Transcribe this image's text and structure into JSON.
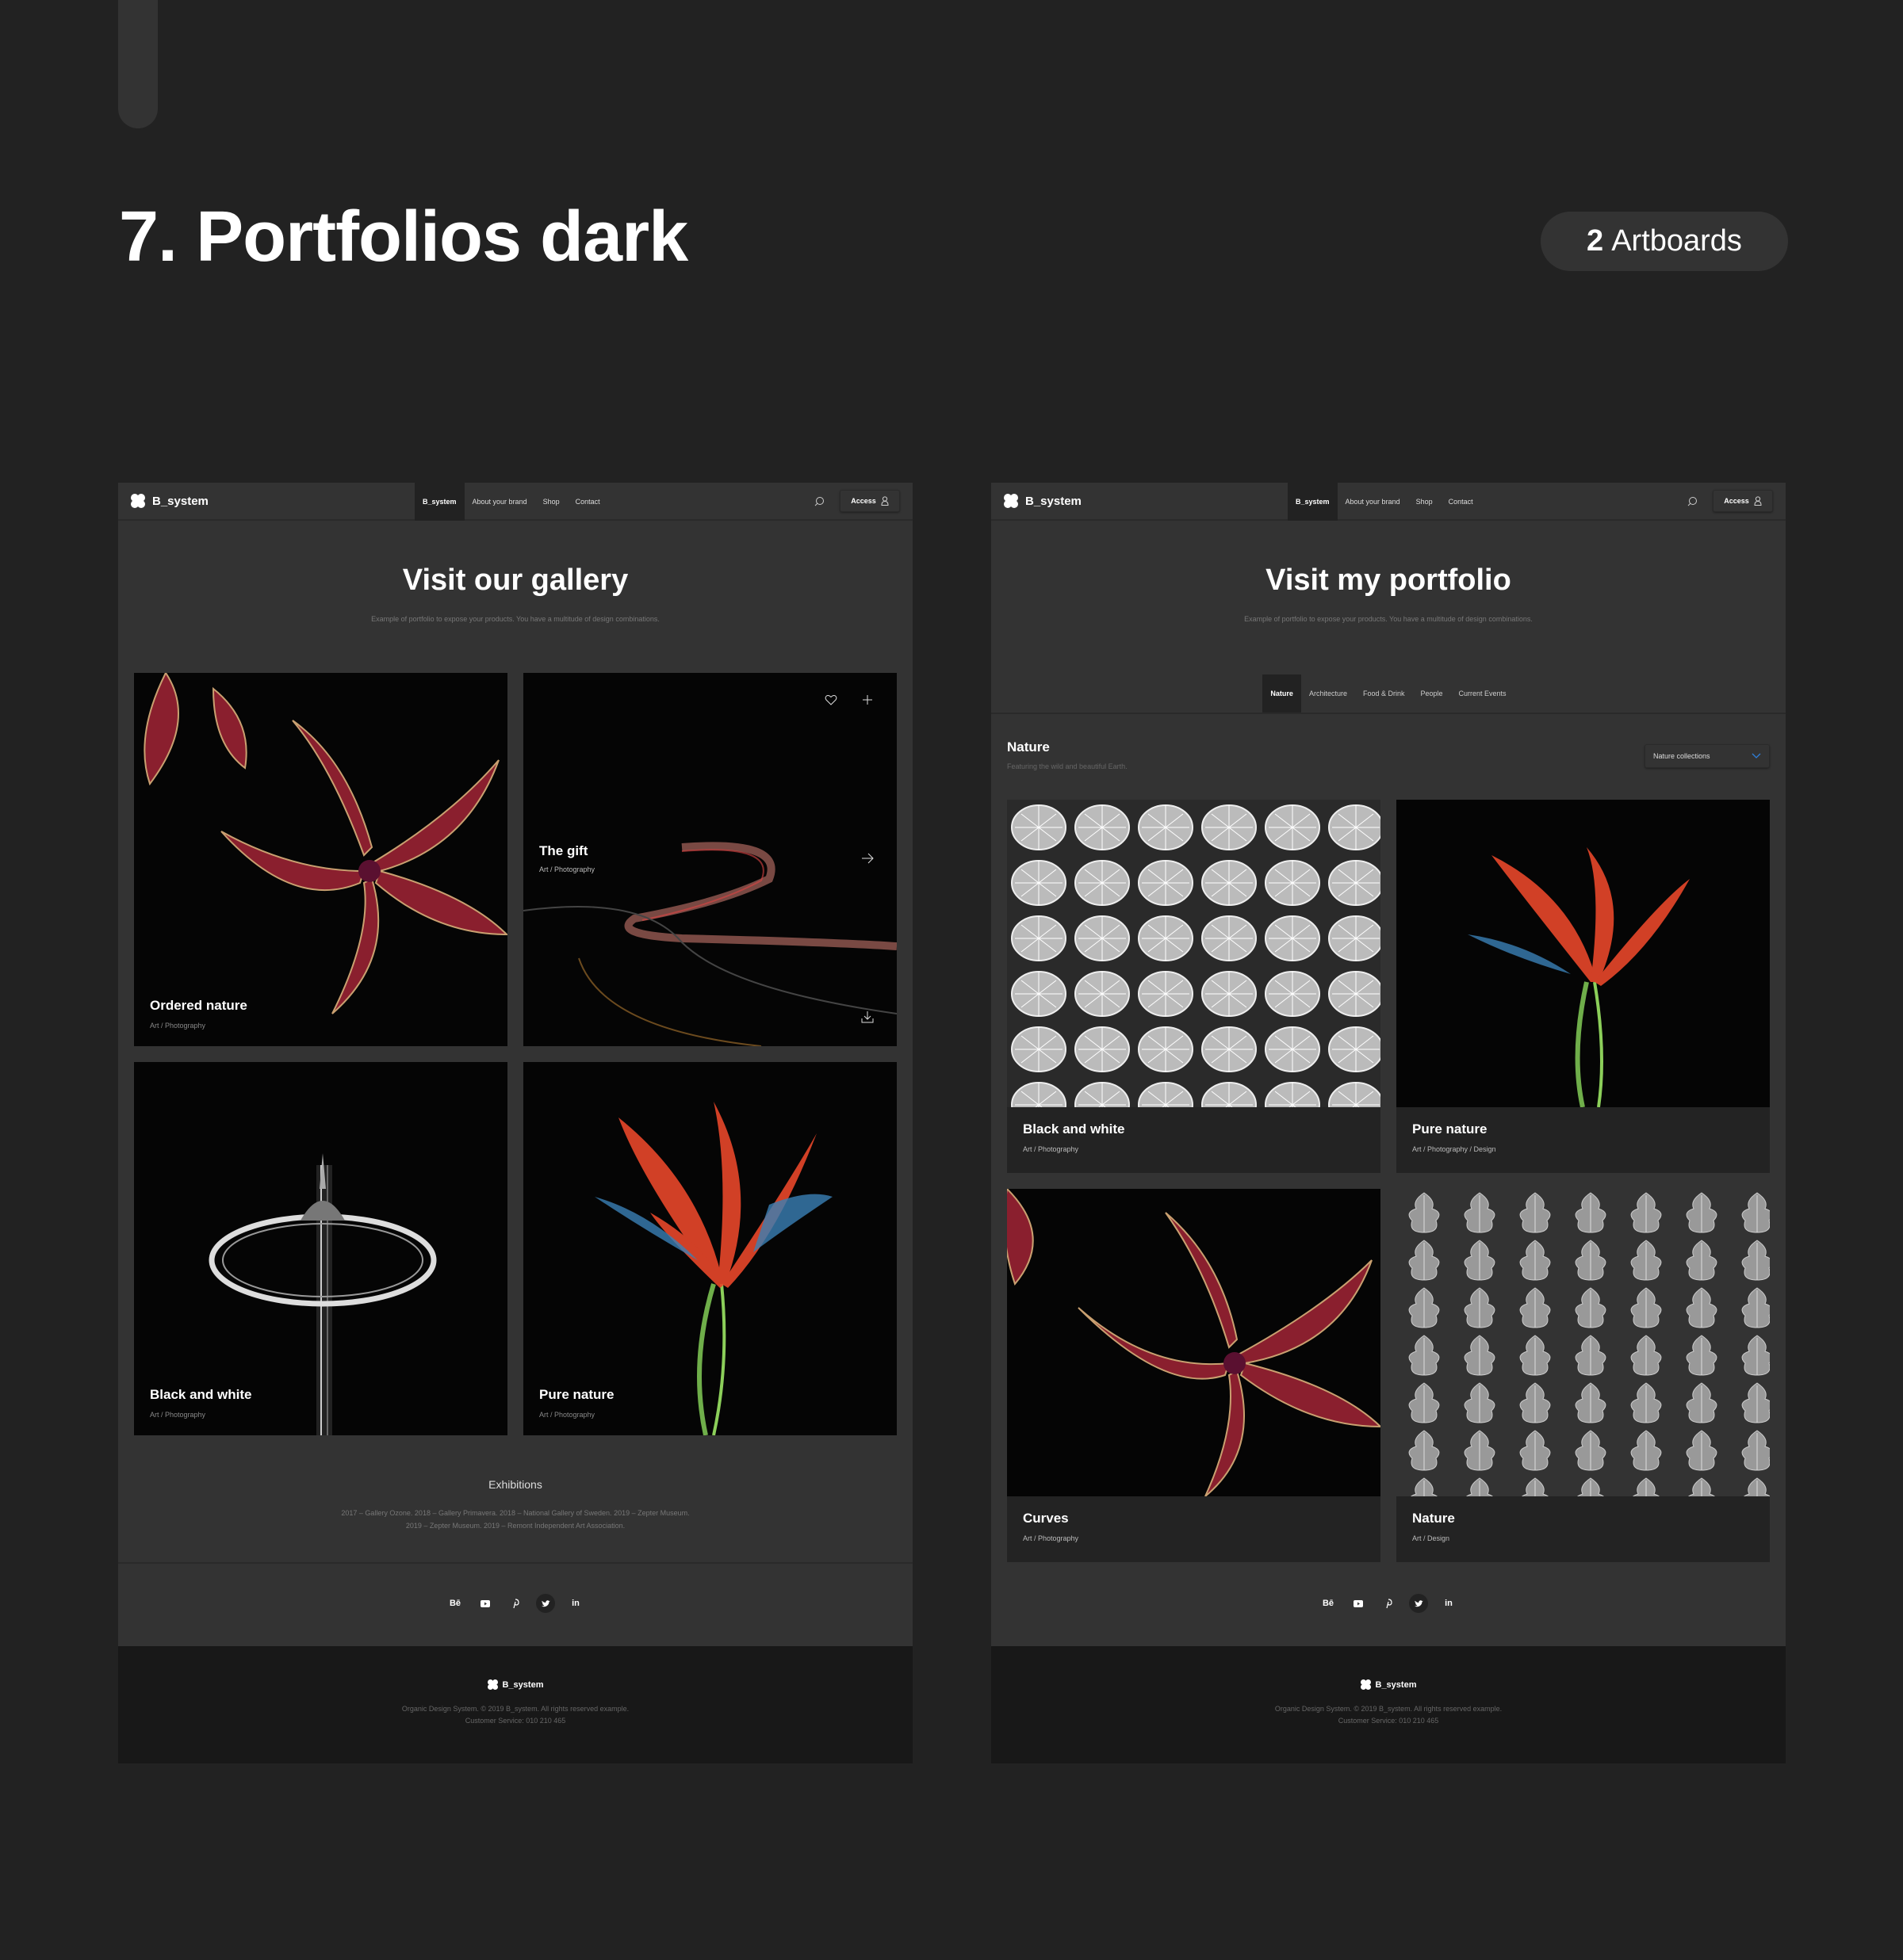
{
  "page": {
    "title": "7. Portfolios dark",
    "badge_count": "2",
    "badge_label": "Artboards"
  },
  "nav": {
    "logo": "B_system",
    "links": [
      "B_system",
      "About your brand",
      "Shop",
      "Contact"
    ],
    "access_label": "Access"
  },
  "artboard1": {
    "hero_title": "Visit our gallery",
    "hero_subtitle": "Example of portfolio to expose your products. You have a multitude of design combinations.",
    "cards": [
      {
        "title": "Ordered nature",
        "subtitle": "Art / Photography"
      },
      {
        "title": "The gift",
        "subtitle": "Art / Photography"
      },
      {
        "title": "Black and white",
        "subtitle": "Art / Photography"
      },
      {
        "title": "Pure nature",
        "subtitle": "Art / Photography"
      }
    ],
    "exhibitions_title": "Exhibitions",
    "exhibitions_text": "2017 – Gallery Ozone. 2018 – Gallery Primavera. 2018 – National Gallery of Sweden. 2019 – Zepter Museum. 2019 – Zepter Museum. 2019 – Remont Independent Art Association."
  },
  "artboard2": {
    "hero_title": "Visit my portfolio",
    "hero_subtitle": "Example of portfolio to expose your products. You have a multitude of design combinations.",
    "tabs": [
      "Nature",
      "Architecture",
      "Food & Drink",
      "People",
      "Current Events"
    ],
    "section_title": "Nature",
    "section_subtitle": "Featuring the wild and beautiful Earth.",
    "dropdown_value": "Nature collections",
    "cards": [
      {
        "title": "Black and white",
        "subtitle": "Art / Photography"
      },
      {
        "title": "Pure nature",
        "subtitle": "Art / Photography / Design"
      },
      {
        "title": "Curves",
        "subtitle": "Art / Photography"
      },
      {
        "title": "Nature",
        "subtitle": "Art / Design"
      }
    ]
  },
  "social": {
    "icons": [
      "behance-icon",
      "youtube-icon",
      "pinterest-icon",
      "twitter-icon",
      "linkedin-icon"
    ],
    "behance_text": "Bē",
    "linkedin_text": "in"
  },
  "footer": {
    "logo": "B_system",
    "line1": "Organic Design System. © 2019 B_system. All rights reserved example.",
    "line2": "Customer Service: 010 210 465"
  },
  "colors": {
    "background": "#222222",
    "artboard": "#333333",
    "footer": "#181818",
    "dropdown_chevron": "#2f7fd8"
  }
}
